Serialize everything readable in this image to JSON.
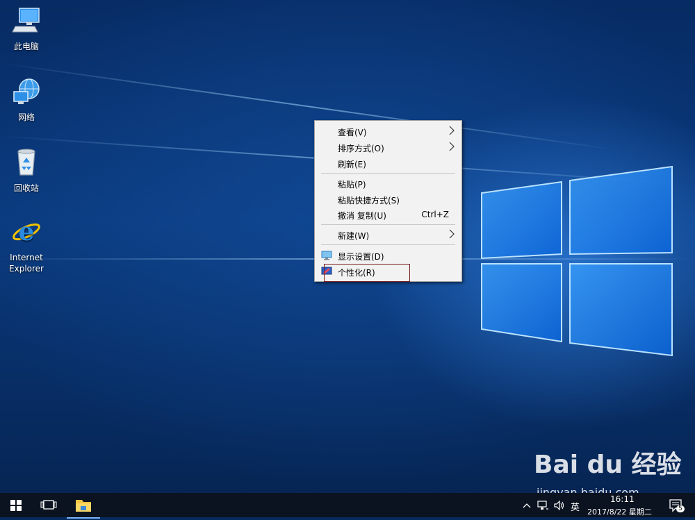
{
  "desktop": {
    "icons": [
      {
        "label": "此电脑",
        "icon": "computer-icon"
      },
      {
        "label": "网络",
        "icon": "network-icon"
      },
      {
        "label": "回收站",
        "icon": "recycle-bin-icon"
      },
      {
        "label": "Internet\nExplorer",
        "icon": "internet-explorer-icon"
      }
    ]
  },
  "context_menu": {
    "items": [
      {
        "label": "查看(V)",
        "submenu": true
      },
      {
        "label": "排序方式(O)",
        "submenu": true
      },
      {
        "label": "刷新(E)"
      },
      {
        "label": "粘贴(P)"
      },
      {
        "label": "粘贴快捷方式(S)"
      },
      {
        "label": "撤消 复制(U)",
        "shortcut": "Ctrl+Z"
      },
      {
        "label": "新建(W)",
        "submenu": true
      },
      {
        "label": "显示设置(D)",
        "icon": "display-settings-icon"
      },
      {
        "label": "个性化(R)",
        "icon": "personalize-icon"
      }
    ],
    "highlighted_item": "个性化(R)"
  },
  "taskbar": {
    "start_icon": "windows-start-icon",
    "task_view_icon": "task-view-icon",
    "pinned": [
      "file-explorer-icon"
    ],
    "tray": {
      "ime": "英",
      "time": "16:11",
      "date": "2017/8/22 星期二",
      "notification_count": "5"
    }
  },
  "watermark": {
    "brand": "Bai du 经验",
    "url": "jingyan.baidu.com"
  },
  "colors": {
    "menu_background": "#f2f2f2",
    "highlight_border": "#7a1c1c",
    "taskbar": "#0b1320"
  }
}
